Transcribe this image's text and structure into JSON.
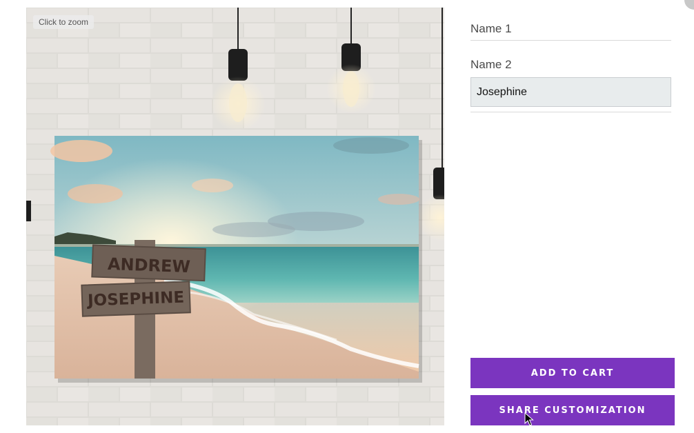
{
  "preview": {
    "zoom_hint": "Click to zoom",
    "sign_names": [
      "ANDREW",
      "JOSEPHINE"
    ]
  },
  "form": {
    "name1": {
      "label": "Name 1",
      "value": ""
    },
    "name2": {
      "label": "Name 2",
      "value": "Josephine"
    }
  },
  "actions": {
    "add_to_cart": "ADD TO CART",
    "share": "SHARE CUSTOMIZATION"
  },
  "colors": {
    "accent": "#7b35bf",
    "input_bg": "#e8eced"
  },
  "icons": {
    "cursor": "pointer-cursor-icon"
  }
}
